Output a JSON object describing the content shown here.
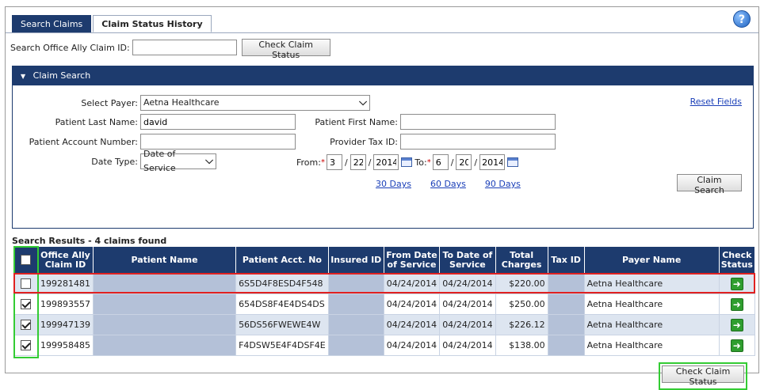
{
  "tabs": [
    {
      "label": "Search Claims",
      "active": false
    },
    {
      "label": "Claim Status History",
      "active": true
    }
  ],
  "top": {
    "claim_id_label": "Search Office Ally Claim ID:",
    "claim_id_value": "",
    "check_button": "Check Claim Status"
  },
  "panel": {
    "title": "Claim Search",
    "reset_link": "Reset Fields",
    "select_payer_label": "Select Payer:",
    "select_payer_value": "Aetna Healthcare",
    "patient_last_name_label": "Patient Last Name:",
    "patient_last_name_value": "david",
    "patient_first_name_label": "Patient First Name:",
    "patient_first_name_value": "",
    "patient_account_label": "Patient Account Number:",
    "patient_account_value": "",
    "provider_tax_label": "Provider Tax ID:",
    "provider_tax_value": "",
    "date_type_label": "Date Type:",
    "date_type_value": "Date of Service",
    "from_label": "From:",
    "from": {
      "month": "3",
      "day": "22",
      "year": "2014"
    },
    "to_label": "To:",
    "to": {
      "month": "6",
      "day": "20",
      "year": "2014"
    },
    "quick_ranges": [
      "30 Days",
      "60 Days",
      "90 Days"
    ],
    "search_button": "Claim Search"
  },
  "results": {
    "title": "Search Results - 4 claims found",
    "headers": [
      "Office Ally Claim ID",
      "Patient Name",
      "Patient Acct. No",
      "Insured ID",
      "From Date of Service",
      "To Date of Service",
      "Total Charges",
      "Tax ID",
      "Payer Name",
      "Check Status"
    ],
    "rows": [
      {
        "checked": false,
        "claim_id": "199281481",
        "acct": "6S5D4F8ESD4F548",
        "from": "04/24/2014",
        "to": "04/24/2014",
        "charges": "$220.00",
        "payer": "Aetna Healthcare"
      },
      {
        "checked": true,
        "claim_id": "199893557",
        "acct": "654DS8F4E4DS4DS",
        "from": "04/24/2014",
        "to": "04/24/2014",
        "charges": "$250.00",
        "payer": "Aetna Healthcare"
      },
      {
        "checked": true,
        "claim_id": "199947139",
        "acct": "56DS56FWEWE4W",
        "from": "04/24/2014",
        "to": "04/24/2014",
        "charges": "$226.12",
        "payer": "Aetna Healthcare"
      },
      {
        "checked": true,
        "claim_id": "199958485",
        "acct": "F4DSW5E4F4DSF4E",
        "from": "04/24/2014",
        "to": "04/24/2014",
        "charges": "$138.00",
        "payer": "Aetna Healthcare"
      }
    ],
    "bottom_button": "Check Claim Status"
  }
}
